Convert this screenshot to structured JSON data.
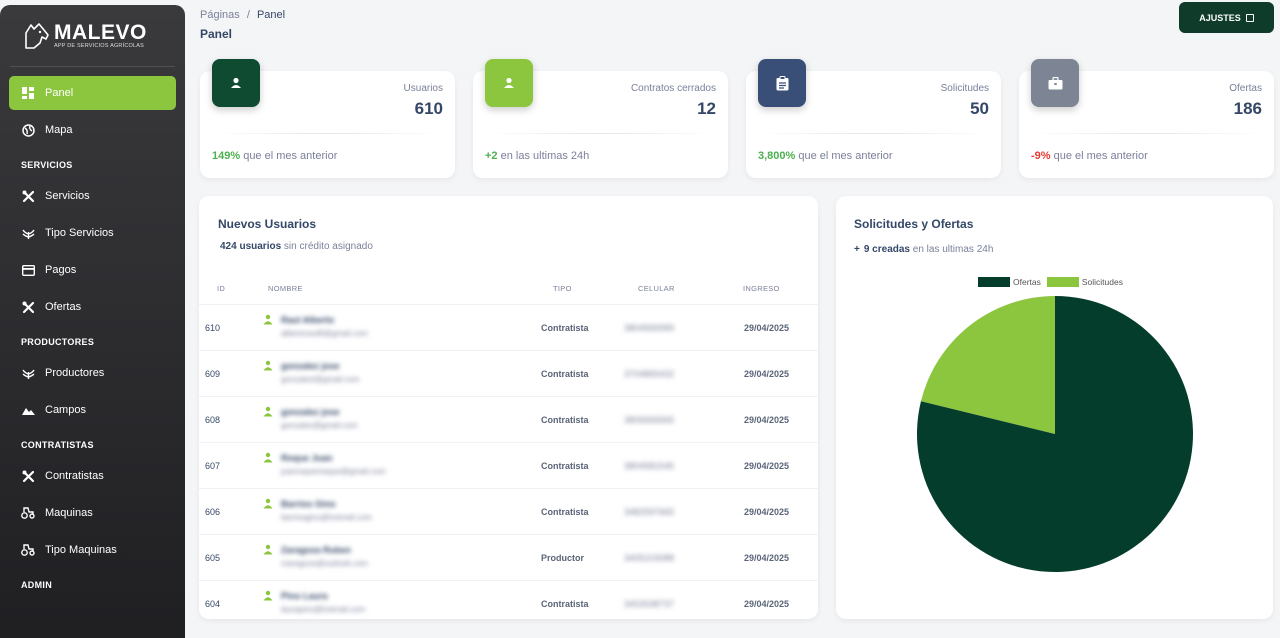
{
  "brand": {
    "name": "MALEVO",
    "tagline": "APP DE SERVICIOS AGRÍCOLAS"
  },
  "sidebar": {
    "items": [
      {
        "label": "Panel",
        "icon": "dashboard-icon",
        "active": true
      },
      {
        "label": "Mapa",
        "icon": "globe-icon"
      }
    ],
    "sections": [
      {
        "title": "SERVICIOS",
        "items": [
          {
            "label": "Servicios",
            "icon": "tools-icon"
          },
          {
            "label": "Tipo Servicios",
            "icon": "agriculture-icon"
          },
          {
            "label": "Pagos",
            "icon": "credit-card-icon"
          },
          {
            "label": "Ofertas",
            "icon": "tools-icon"
          }
        ]
      },
      {
        "title": "PRODUCTORES",
        "items": [
          {
            "label": "Productores",
            "icon": "agriculture-icon"
          },
          {
            "label": "Campos",
            "icon": "landscape-icon"
          }
        ]
      },
      {
        "title": "CONTRATISTAS",
        "items": [
          {
            "label": "Contratistas",
            "icon": "tools-icon"
          },
          {
            "label": "Maquinas",
            "icon": "tractor-icon"
          },
          {
            "label": "Tipo Maquinas",
            "icon": "tractor-icon"
          }
        ]
      },
      {
        "title": "ADMIN",
        "items": []
      }
    ]
  },
  "header": {
    "breadcrumb_root": "Páginas",
    "breadcrumb_sep": "/",
    "breadcrumb_current": "Panel",
    "title": "Panel",
    "settings_label": "AJUSTES"
  },
  "stats": [
    {
      "label": "Usuarios",
      "value": "610",
      "delta": "149%",
      "delta_text": " que el mes anterior",
      "trend": "positive",
      "color": "#0f4b31",
      "icon": "person-icon"
    },
    {
      "label": "Contratos cerrados",
      "value": "12",
      "delta": "+2",
      "delta_text": " en las ultimas 24h",
      "trend": "positive",
      "color": "#8cc63f",
      "icon": "person-icon"
    },
    {
      "label": "Solicitudes",
      "value": "50",
      "delta": "3,800%",
      "delta_text": " que el mes anterior",
      "trend": "positive",
      "color": "#3a4f77",
      "icon": "clipboard-icon"
    },
    {
      "label": "Ofertas",
      "value": "186",
      "delta": "-9%",
      "delta_text": " que el mes anterior",
      "trend": "negative",
      "color": "#7d8493",
      "icon": "briefcase-icon"
    }
  ],
  "users": {
    "title": "Nuevos Usuarios",
    "count": "424 usuarios",
    "count_text": " sin crédito asignado",
    "columns": [
      "ID",
      "NOMBRE",
      "TIPO",
      "CELULAR",
      "INGRESO"
    ],
    "rows": [
      {
        "id": "610",
        "name": "Raul Alberto",
        "email": "albertoraul9@gmail.com",
        "tipo": "Contratista",
        "celular": "3804565999",
        "ingreso": "29/04/2025"
      },
      {
        "id": "609",
        "name": "gonzalez jose",
        "email": "gonzalezl@gmail.com",
        "tipo": "Contratista",
        "celular": "3704865432",
        "ingreso": "29/04/2025"
      },
      {
        "id": "608",
        "name": "gonzalez jose",
        "email": "gonzalez@gmail.com",
        "tipo": "Contratista",
        "celular": "3806566565",
        "ingreso": "29/04/2025"
      },
      {
        "id": "607",
        "name": "Roque Juan",
        "email": "juanroquemaque@gmail.com",
        "tipo": "Contratista",
        "celular": "3804581545",
        "ingreso": "29/04/2025"
      },
      {
        "id": "606",
        "name": "Barrios Gino",
        "email": "barriosgino@hotmail.com",
        "tipo": "Contratista",
        "celular": "3482597665",
        "ingreso": "29/04/2025"
      },
      {
        "id": "605",
        "name": "Zaragoza Ruben",
        "email": "rzaragoza@outlook.com",
        "tipo": "Productor",
        "celular": "3405103088",
        "ingreso": "29/04/2025"
      },
      {
        "id": "604",
        "name": "Pino Laura",
        "email": "laurapino@hotmail.com",
        "tipo": "Contratista",
        "celular": "3402638737",
        "ingreso": "29/04/2025"
      }
    ]
  },
  "chart_panel": {
    "title": "Solicitudes y Ofertas",
    "sub_plus": "+",
    "sub_bold": "9 creadas",
    "sub_text": " en las ultimas 24h"
  },
  "chart_data": {
    "type": "pie",
    "categories": [
      "Ofertas",
      "Solicitudes"
    ],
    "values": [
      186,
      50
    ],
    "colors": [
      "#053d2c",
      "#8cc63f"
    ],
    "legend": "top"
  }
}
